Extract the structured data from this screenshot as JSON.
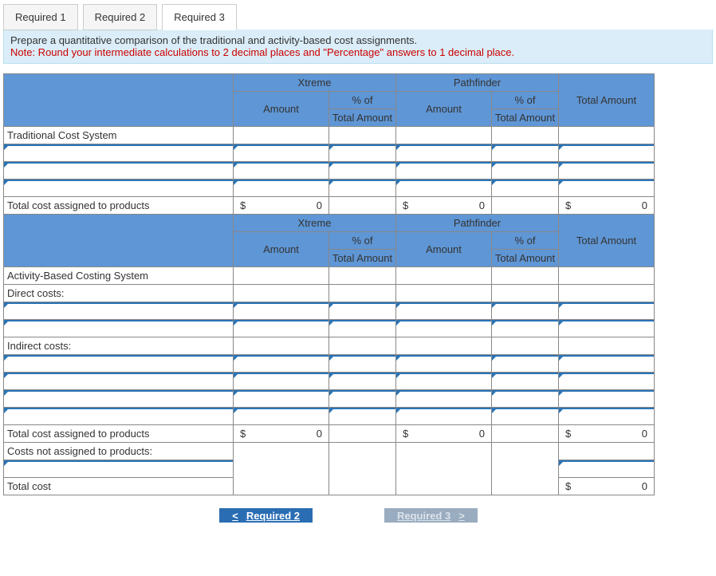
{
  "tabs": [
    {
      "label": "Required 1",
      "active": false
    },
    {
      "label": "Required 2",
      "active": false
    },
    {
      "label": "Required 3",
      "active": true
    }
  ],
  "instructions": {
    "line1": "Prepare a quantitative comparison of the traditional and activity-based cost assignments.",
    "line2": "Note: Round your intermediate calculations to 2 decimal places and \"Percentage\" answers to 1 decimal place."
  },
  "headers": {
    "product1": "Xtreme",
    "product2": "Pathfinder",
    "amount": "Amount",
    "pctOfTop": "% of",
    "pctOfBot": "Total Amount",
    "totalAmount": "Total Amount"
  },
  "rows": {
    "traditional": "Traditional Cost System",
    "totalAssigned": "Total cost assigned to products",
    "abc": "Activity-Based Costing System",
    "direct": "Direct costs:",
    "indirect": "Indirect costs:",
    "costsNotAssigned": "Costs not assigned to products:",
    "totalCost": "Total cost"
  },
  "values": {
    "dollar": "$",
    "zero": "0"
  },
  "nav": {
    "prev": "Required 2",
    "next": "Required 3"
  }
}
